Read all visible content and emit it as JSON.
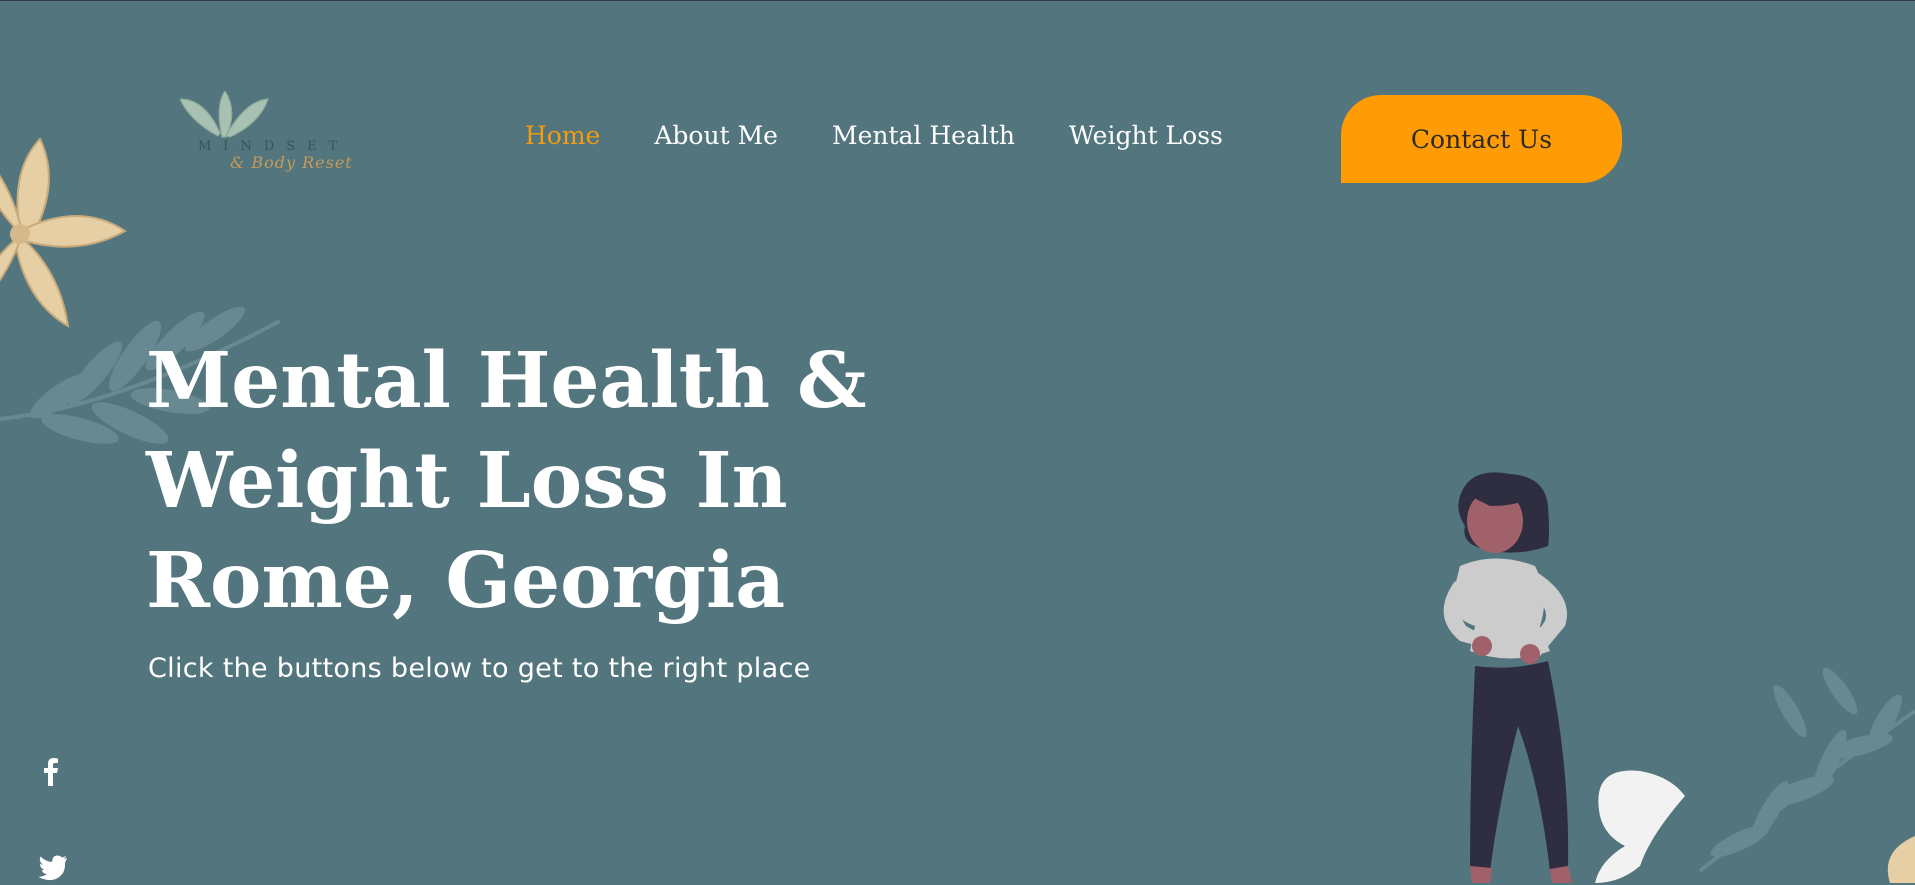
{
  "logo": {
    "wordmark": "MINDSET",
    "script": "& Body Reset"
  },
  "nav": {
    "items": [
      {
        "label": "Home",
        "active": true
      },
      {
        "label": "About Me",
        "active": false
      },
      {
        "label": "Mental Health",
        "active": false
      },
      {
        "label": "Weight Loss",
        "active": false
      }
    ]
  },
  "header": {
    "contact_label": "Contact Us"
  },
  "hero": {
    "title": "Mental Health & Weight Loss In Rome, Georgia",
    "subtitle": "Click the buttons below to get to the right place"
  },
  "social": {
    "icons": [
      "facebook-icon",
      "twitter-icon"
    ]
  },
  "colors": {
    "background": "#53757e",
    "accent": "#ff9b05",
    "nav_active": "#f39c12",
    "text": "#ffffff"
  }
}
